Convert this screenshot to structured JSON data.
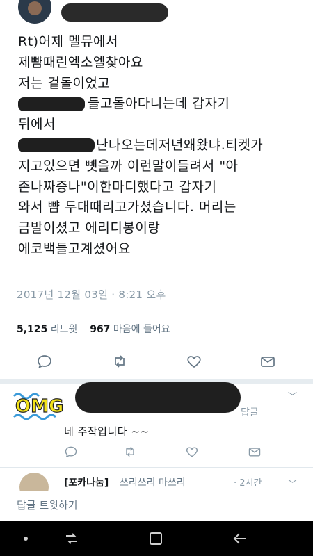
{
  "tweet": {
    "lines": [
      "Rt)어제 멜뮤에서",
      "제뺨때린엑소엘찾아요",
      "저는 겉돌이었고",
      "들고돌아다니는데 갑자기",
      "뒤에서",
      "난나오는데저년왜왔냐.티켓가",
      "지고있으면 뺏을까 이런말이들려서 \"아",
      "존나짜증나\"이한마디했다고 갑자기",
      "와서 뺨 두대때리고가셨습니다. 머리는",
      "금발이셨고 에리디봉이랑",
      "에코백들고계셨어요"
    ],
    "timestamp": "2017년 12월 03일 · 8:21 오후",
    "retweets_count": "5,125",
    "retweets_label": "리트윗",
    "likes_count": "967",
    "likes_label": "마음에 들어요"
  },
  "actions": [
    "reply-icon",
    "retweet-icon",
    "like-icon",
    "message-icon"
  ],
  "reply1": {
    "sticker_text": "OMG",
    "extra": "답글",
    "text": "네 주작입니다 ~~",
    "caret": "﹀"
  },
  "reply2": {
    "name": "[포카나눔]",
    "handle": "쓰리쓰리 마쓰리",
    "time": "· 2시간",
    "caret": "﹀"
  },
  "composer": {
    "placeholder": "답글 트윗하기"
  },
  "colors": {
    "muted": "#8899a6",
    "divider": "#e1e8ed",
    "text": "#14171a",
    "sticker_yellow": "#f2e21a",
    "sticker_blue": "#3a9ad9"
  }
}
